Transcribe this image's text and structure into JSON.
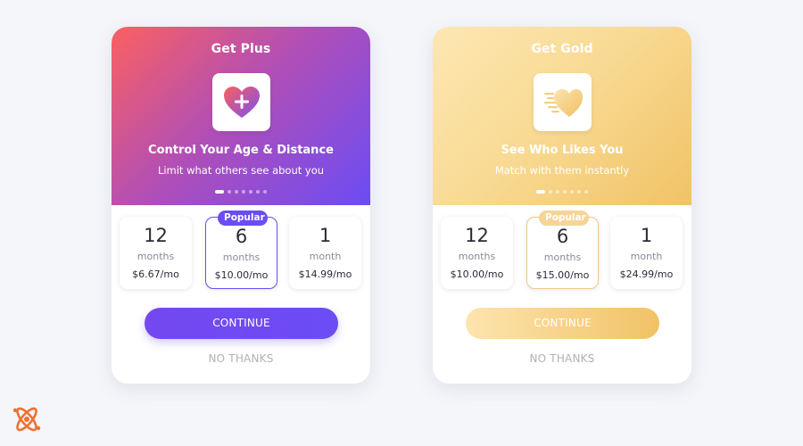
{
  "colors": {
    "plus_accent": "#6b4cf5",
    "plus_gradient_start": "#fb6060",
    "gold_accent": "#f1c266",
    "gold_gradient_start": "#fde7b3",
    "no_thanks": "#b0b0b8",
    "logo": "#f07030"
  },
  "cards": [
    {
      "title": "Get Plus",
      "feature_icon": "heart-plus-icon",
      "feature_title": "Control Your Age & Distance",
      "feature_subtitle": "Limit what others see about you",
      "carousel_active_index": 0,
      "plans": [
        {
          "count": "12",
          "unit": "months",
          "price": "$6.67/mo",
          "popular": false
        },
        {
          "count": "6",
          "unit": "months",
          "price": "$10.00/mo",
          "popular": true
        },
        {
          "count": "1",
          "unit": "month",
          "price": "$14.99/mo",
          "popular": false
        }
      ],
      "popular_label": "Popular",
      "continue_label": "CONTINUE",
      "no_thanks_label": "NO THANKS"
    },
    {
      "title": "Get Gold",
      "feature_icon": "heart-speed-icon",
      "feature_title": "See Who Likes You",
      "feature_subtitle": "Match with them instantly",
      "carousel_active_index": 0,
      "plans": [
        {
          "count": "12",
          "unit": "months",
          "price": "$10.00/mo",
          "popular": false
        },
        {
          "count": "6",
          "unit": "months",
          "price": "$15.00/mo",
          "popular": true
        },
        {
          "count": "1",
          "unit": "month",
          "price": "$24.99/mo",
          "popular": false
        }
      ],
      "popular_label": "Popular",
      "continue_label": "CONTINUE",
      "no_thanks_label": "NO THANKS"
    }
  ]
}
